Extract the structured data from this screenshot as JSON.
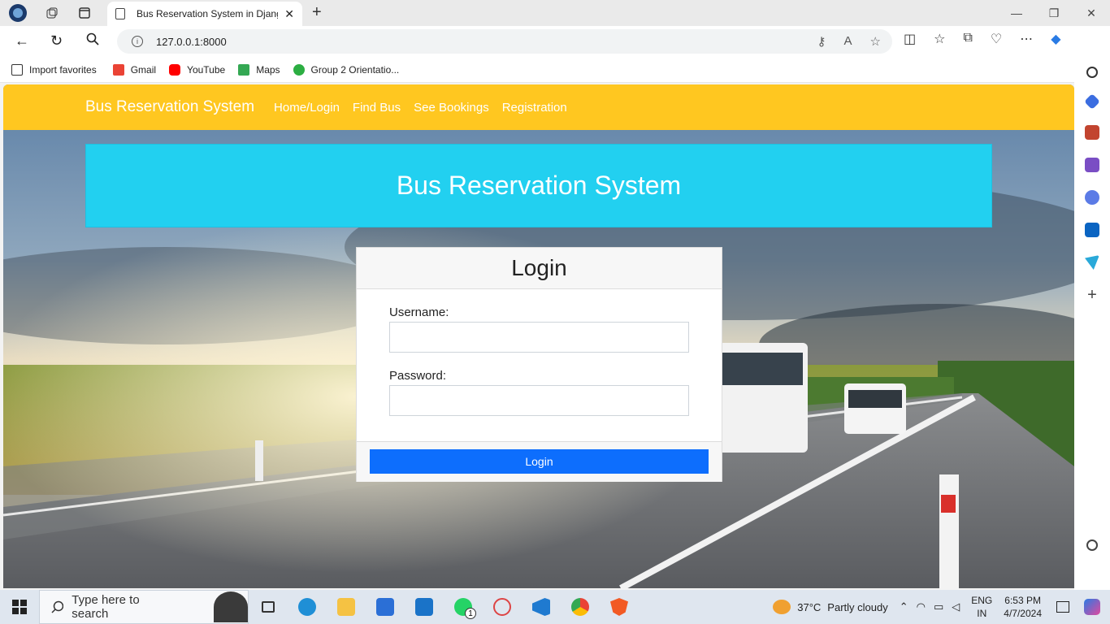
{
  "browser": {
    "tab_title": "Bus Reservation System in Djang",
    "url": "127.0.0.1:8000",
    "favorites": [
      {
        "label": "Import favorites",
        "icon": "import-icon"
      },
      {
        "label": "Gmail",
        "icon": "gmail-icon"
      },
      {
        "label": "YouTube",
        "icon": "youtube-icon"
      },
      {
        "label": "Maps",
        "icon": "maps-icon"
      },
      {
        "label": "Group 2 Orientatio...",
        "icon": "group-icon"
      }
    ]
  },
  "navbar": {
    "brand": "Bus Reservation System",
    "links": [
      "Home/Login",
      "Find Bus",
      "See Bookings",
      "Registration"
    ]
  },
  "hero": {
    "title": "Bus Reservation System"
  },
  "login": {
    "title": "Login",
    "username_label": "Username:",
    "password_label": "Password:",
    "button": "Login"
  },
  "taskbar": {
    "search_placeholder": "Type here to search",
    "weather_temp": "37°C",
    "weather_desc": "Partly cloudy",
    "lang1": "ENG",
    "lang2": "IN",
    "time": "6:53 PM",
    "date": "4/7/2024",
    "whatsapp_badge": "1"
  },
  "colors": {
    "navbar": "#ffc720",
    "hero": "#22d0f0",
    "button": "#0d6efd"
  }
}
